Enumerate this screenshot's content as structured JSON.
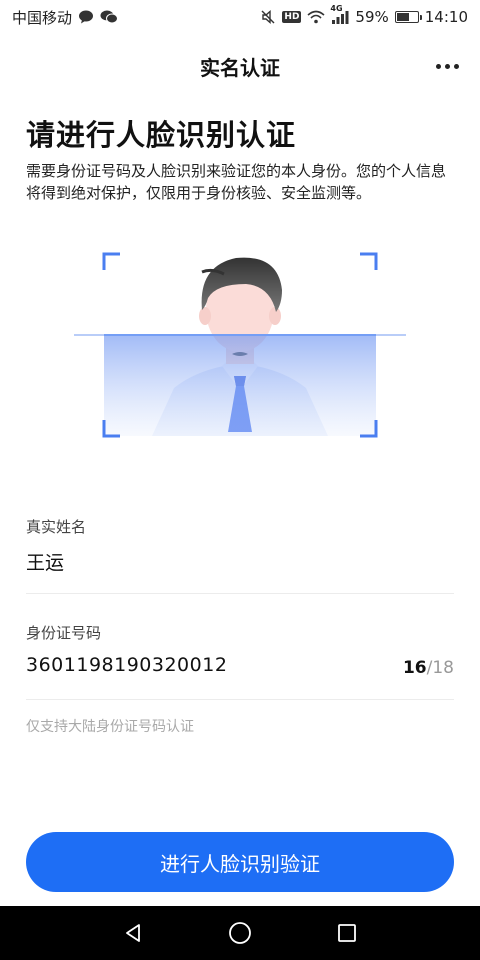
{
  "status_bar": {
    "carrier": "中国移动",
    "network_badge": "HD",
    "signal_label": "4G",
    "battery_text": "59%",
    "battery_level": 0.59,
    "time": "14:10"
  },
  "nav": {
    "title": "实名认证"
  },
  "intro": {
    "heading": "请进行人脸识别认证",
    "description": "需要身份证号码及人脸识别来验证您的本人身份。您的个人信息将得到绝对保护，仅限用于身份核验、安全监测等。"
  },
  "form": {
    "name_label": "真实姓名",
    "name_value": "王运",
    "id_label": "身份证号码",
    "id_value": "3601198190320012",
    "id_count_current": "16",
    "id_count_total": "/18",
    "hint": "仅支持大陆身份证号码认证"
  },
  "actions": {
    "submit_label": "进行人脸识别验证"
  },
  "colors": {
    "primary": "#1e6ef5",
    "scan_frame": "#4a7ef0"
  }
}
